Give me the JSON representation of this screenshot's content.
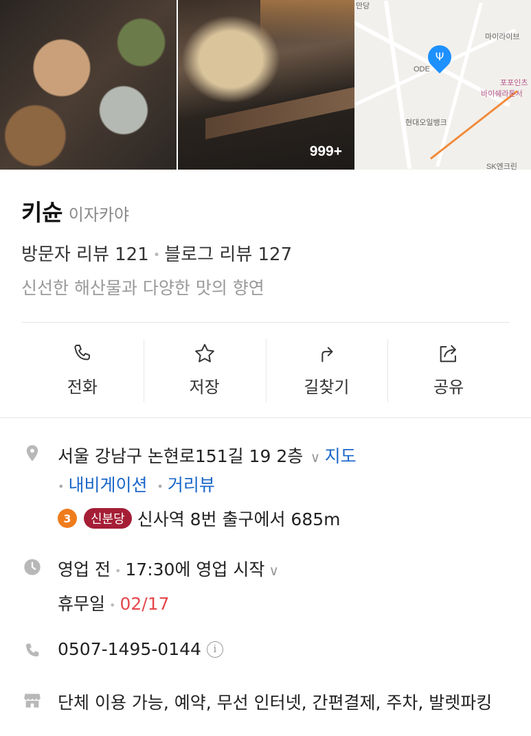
{
  "photos": {
    "count_badge": "999+"
  },
  "map": {
    "labels": [
      "만당",
      "마이라이브",
      "ODE",
      "포포인츠",
      "바이쉐라톤서",
      "현대오일뱅크",
      "SK엔크린"
    ],
    "pin_color": "#1e90ff"
  },
  "place": {
    "name": "키슌",
    "category": "이자카야",
    "visitor_reviews": "방문자 리뷰 121",
    "blog_reviews": "블로그 리뷰 127",
    "description": "신선한 해산물과 다양한 맛의 향연"
  },
  "actions": [
    {
      "label": "전화",
      "icon": "phone-icon"
    },
    {
      "label": "저장",
      "icon": "star-icon"
    },
    {
      "label": "길찾기",
      "icon": "directions-icon"
    },
    {
      "label": "공유",
      "icon": "share-icon"
    }
  ],
  "address": {
    "text": "서울 강남구 논현로151길 19 2층",
    "map_link": "지도",
    "navigation_link": "내비게이션",
    "streetview_link": "거리뷰"
  },
  "subway": {
    "line_number": "3",
    "line_name": "신분당",
    "directions": "신사역 8번 출구에서 685m",
    "line_number_color": "#ef7c1c",
    "line_name_color": "#a51e36"
  },
  "hours": {
    "status": "영업 전",
    "start_text": "17:30에 영업 시작",
    "holiday_label": "휴무일",
    "holiday_date": "02/17"
  },
  "phone": {
    "number": "0507-1495-0144"
  },
  "facilities": {
    "text": "단체 이용 가능, 예약, 무선 인터넷, 간편결제, 주차, 발렛파킹"
  },
  "colors": {
    "link": "#1a66c9",
    "holiday_date": "#e5474b"
  }
}
